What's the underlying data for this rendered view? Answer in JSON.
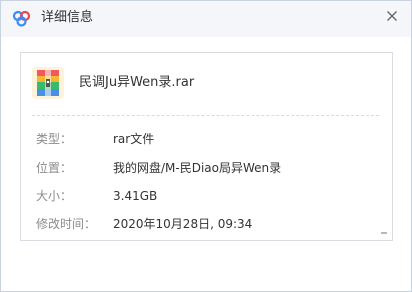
{
  "dialog": {
    "title": "详细信息"
  },
  "file": {
    "name": "民调Ju异Wen录.rar"
  },
  "details": [
    {
      "label": "类型：",
      "value": "rar文件"
    },
    {
      "label": "位置：",
      "value": "我的网盘/M-民Diao局异Wen录"
    },
    {
      "label": "大小：",
      "value": "3.41GB"
    },
    {
      "label": "修改时间：",
      "value": "2020年10月28日, 09:34"
    }
  ],
  "colors": {
    "titlebar_bg": "#f4f6f9",
    "label_text": "#8c8c8c",
    "value_text": "#333333",
    "logo_blue": "#3b8cf5"
  },
  "icons": {
    "app": "baidu-netdisk-logo-icon",
    "close": "close-icon",
    "file": "rar-archive-icon"
  }
}
